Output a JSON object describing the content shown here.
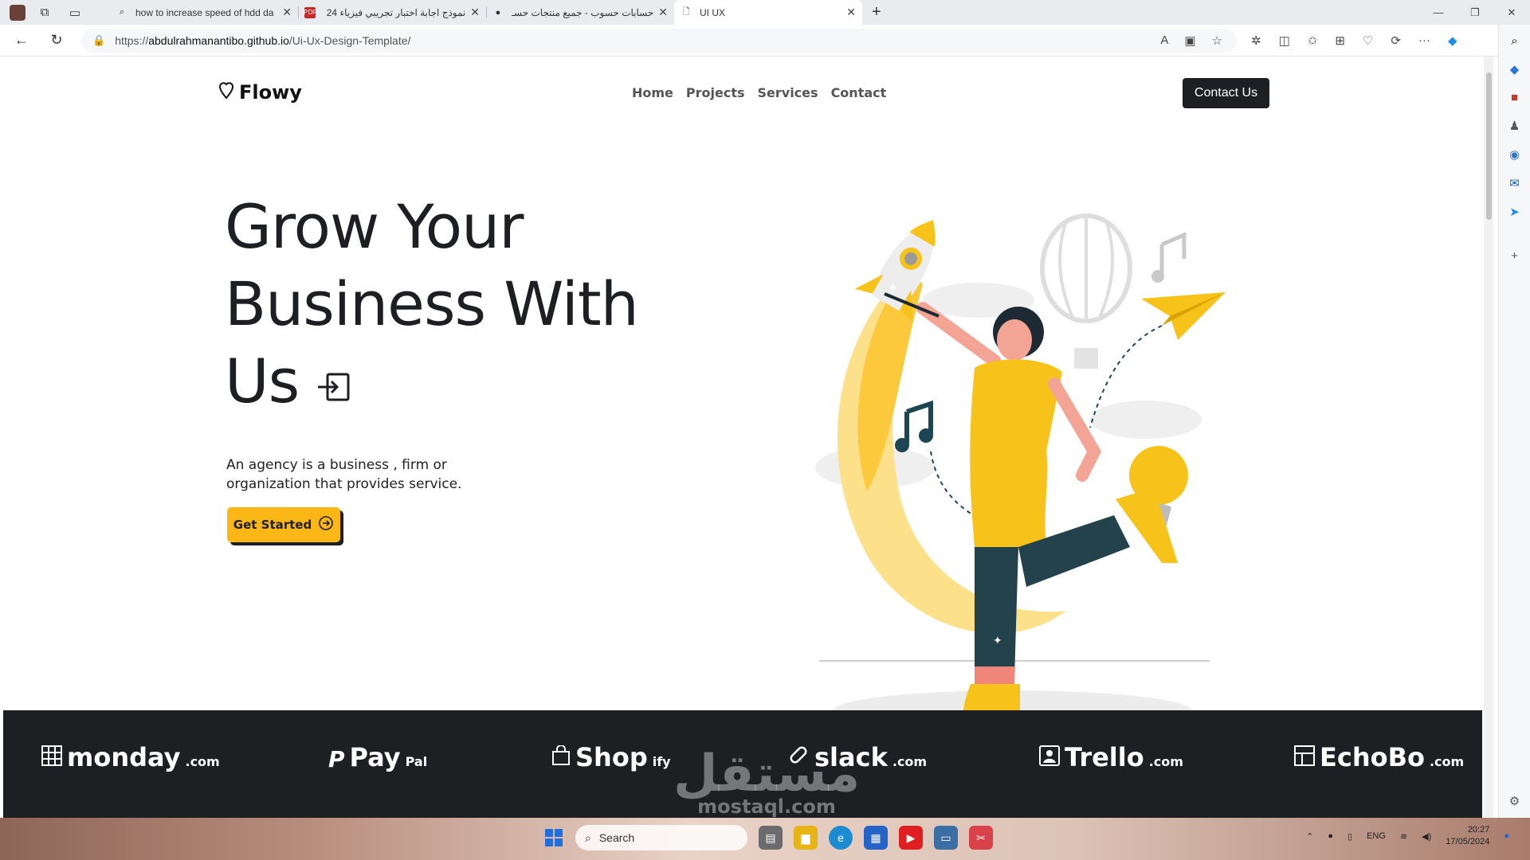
{
  "browser": {
    "tabs": [
      {
        "title": "how to increase speed of hdd da",
        "favicon": "search-icon"
      },
      {
        "title": "نموذج اجابة اختبار تجريبي فيزياء 24",
        "favicon": "pdf-icon"
      },
      {
        "title": "حسابات حسوب - جميع منتجات حسـ",
        "favicon": "hsoub-icon"
      },
      {
        "title": "UI UX",
        "favicon": "page-icon"
      }
    ],
    "url_prefix": "https://",
    "url_host": "abdulrahmanantibo.github.io",
    "url_path": "/Ui-Ux-Design-Template/"
  },
  "page": {
    "brand_name": "Flowy",
    "nav": [
      "Home",
      "Projects",
      "Services",
      "Contact"
    ],
    "contact_button": "Contact Us",
    "hero_title_line1": "Grow Your",
    "hero_title_line2": "Business With",
    "hero_title_line3": "Us",
    "hero_description": "An agency is a business , firm or organization that provides service.",
    "cta_label": "Get Started",
    "brands": [
      {
        "name": "monday",
        "suffix": ".com",
        "icon": "monday-grid-icon"
      },
      {
        "name": "Pay",
        "suffix": "Pal",
        "icon": "paypal-icon"
      },
      {
        "name": "Shop",
        "suffix": "ify",
        "icon": "shopping-bag-icon"
      },
      {
        "name": "slack",
        "suffix": ".com",
        "icon": "slack-bandage-icon"
      },
      {
        "name": "Trello",
        "suffix": ".com",
        "icon": "trello-user-icon"
      },
      {
        "name": "EchoBo",
        "suffix": ".com",
        "icon": "echobo-layout-icon"
      }
    ],
    "colors": {
      "accent": "#fbb715",
      "dark": "#1d1f22",
      "text": "#222222"
    }
  },
  "watermark": {
    "text": "مستقل",
    "sub": "mostaql.com"
  },
  "taskbar": {
    "search_placeholder": "Search",
    "language": "ENG",
    "time": "20:27",
    "date": "17/05/2024"
  }
}
